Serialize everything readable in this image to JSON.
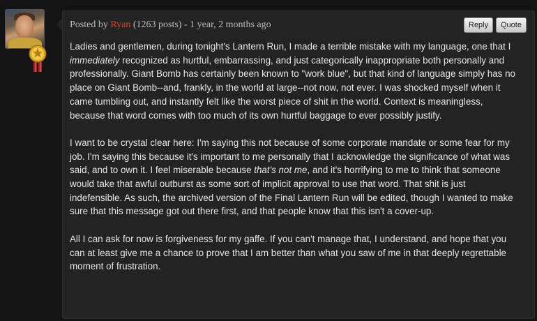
{
  "post": {
    "author_prefix": "Posted by ",
    "author": "Ryan",
    "post_count": " (1263 posts)",
    "separator": " - ",
    "timestamp": "1 year, 2 months ago",
    "reply_label": "Reply",
    "quote_label": "Quote",
    "paragraphs": [
      [
        {
          "text": "Ladies and gentlemen, during tonight's Lantern Run, I made a terrible mistake with my language, one that I "
        },
        {
          "text": "immediately",
          "em": true
        },
        {
          "text": " recognized as hurtful, embarrassing, and just categorically inappropriate both personally and professionally. Giant Bomb has certainly been known to \"work blue\", but that kind of language simply has no place on Giant Bomb--and, frankly, in the world at large--not now, not ever. I was shocked myself when it came tumbling out, and instantly felt like the worst piece of shit in the world. Context is meaningless, because that word comes with too much of its own hurtful baggage to ever possibly justify."
        }
      ],
      [
        {
          "text": "I want to be crystal clear here: I'm saying this not because of some corporate mandate or some fear for my job. I'm saying this because it's important to me personally that I acknowledge the significance of what was said, and to own it. I feel miserable because "
        },
        {
          "text": "that's not me",
          "em": true
        },
        {
          "text": ", and it's horrifying to me to think that someone would take that awful outburst as some sort of implicit approval to use that word. That shit is just indefensible. As such, the archived version of the Final Lantern Run will be edited, though I wanted to make sure that this message got out there first, and that people know that this isn't a cover-up."
        }
      ],
      [
        {
          "text": "All I can ask for now is forgiveness for my gaffe. If you can't manage that, I understand, and hope that you can at least give me a chance to prove that I am better than what you saw of me in that deeply regrettable moment of frustration."
        }
      ]
    ]
  },
  "colors": {
    "background": "#141414",
    "post_background": "#232323",
    "author_link": "#d9432b",
    "body_text": "#e6e6e6"
  },
  "icons": {
    "avatar": "user-avatar-image",
    "badge": "gold-medal-icon"
  }
}
